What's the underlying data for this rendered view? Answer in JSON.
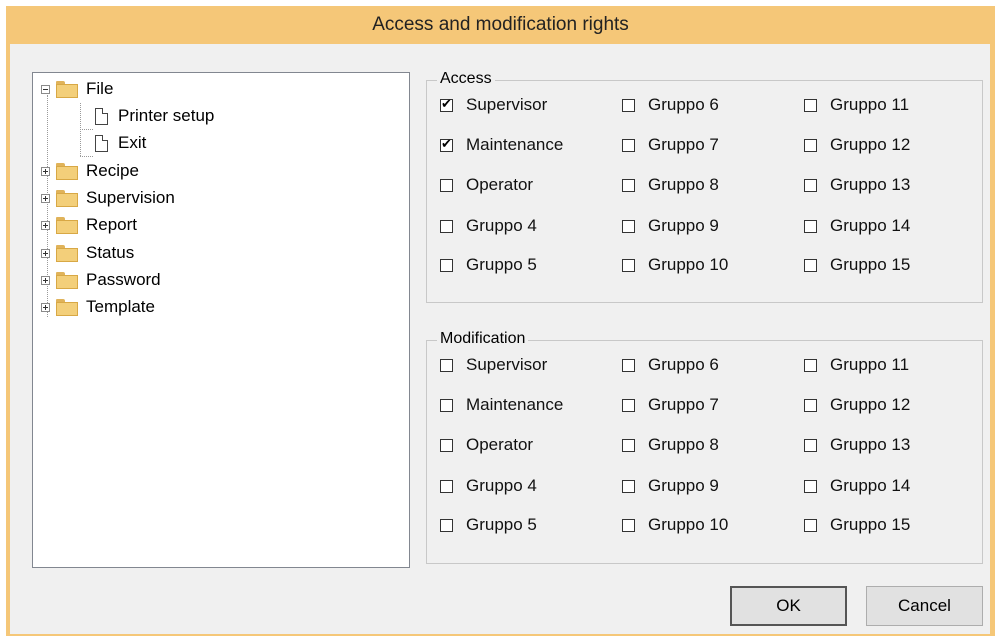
{
  "window": {
    "title": "Access and modification rights"
  },
  "tree": {
    "items": [
      {
        "label": "File",
        "type": "folder",
        "expanded": true,
        "icon": "folder-icon"
      },
      {
        "label": "Printer setup",
        "type": "document",
        "icon": "document-icon"
      },
      {
        "label": "Exit",
        "type": "document",
        "icon": "document-icon"
      },
      {
        "label": "Recipe",
        "type": "folder",
        "expanded": false,
        "icon": "folder-icon"
      },
      {
        "label": "Supervision",
        "type": "folder",
        "expanded": false,
        "icon": "folder-icon"
      },
      {
        "label": "Report",
        "type": "folder",
        "expanded": false,
        "icon": "folder-icon"
      },
      {
        "label": "Status",
        "type": "folder",
        "expanded": false,
        "icon": "folder-icon"
      },
      {
        "label": "Password",
        "type": "folder",
        "expanded": false,
        "icon": "folder-icon"
      },
      {
        "label": "Template",
        "type": "folder",
        "expanded": false,
        "icon": "folder-icon"
      }
    ]
  },
  "access": {
    "label": "Access",
    "checks": [
      {
        "label": "Supervisor",
        "checked": true
      },
      {
        "label": "Maintenance",
        "checked": true
      },
      {
        "label": "Operator",
        "checked": false
      },
      {
        "label": "Gruppo 4",
        "checked": false
      },
      {
        "label": "Gruppo 5",
        "checked": false
      },
      {
        "label": "Gruppo 6",
        "checked": false
      },
      {
        "label": "Gruppo 7",
        "checked": false
      },
      {
        "label": "Gruppo 8",
        "checked": false
      },
      {
        "label": "Gruppo 9",
        "checked": false
      },
      {
        "label": "Gruppo 10",
        "checked": false
      },
      {
        "label": "Gruppo 11",
        "checked": false
      },
      {
        "label": "Gruppo 12",
        "checked": false
      },
      {
        "label": "Gruppo 13",
        "checked": false
      },
      {
        "label": "Gruppo 14",
        "checked": false
      },
      {
        "label": "Gruppo 15",
        "checked": false
      }
    ]
  },
  "modification": {
    "label": "Modification",
    "checks": [
      {
        "label": "Supervisor",
        "checked": false
      },
      {
        "label": "Maintenance",
        "checked": false
      },
      {
        "label": "Operator",
        "checked": false
      },
      {
        "label": "Gruppo 4",
        "checked": false
      },
      {
        "label": "Gruppo 5",
        "checked": false
      },
      {
        "label": "Gruppo 6",
        "checked": false
      },
      {
        "label": "Gruppo 7",
        "checked": false
      },
      {
        "label": "Gruppo 8",
        "checked": false
      },
      {
        "label": "Gruppo 9",
        "checked": false
      },
      {
        "label": "Gruppo 10",
        "checked": false
      },
      {
        "label": "Gruppo 11",
        "checked": false
      },
      {
        "label": "Gruppo 12",
        "checked": false
      },
      {
        "label": "Gruppo 13",
        "checked": false
      },
      {
        "label": "Gruppo 14",
        "checked": false
      },
      {
        "label": "Gruppo 15",
        "checked": false
      }
    ]
  },
  "buttons": {
    "ok": "OK",
    "cancel": "Cancel"
  },
  "colors": {
    "titlebar": "#f5c778",
    "client": "#f0f0f0"
  }
}
